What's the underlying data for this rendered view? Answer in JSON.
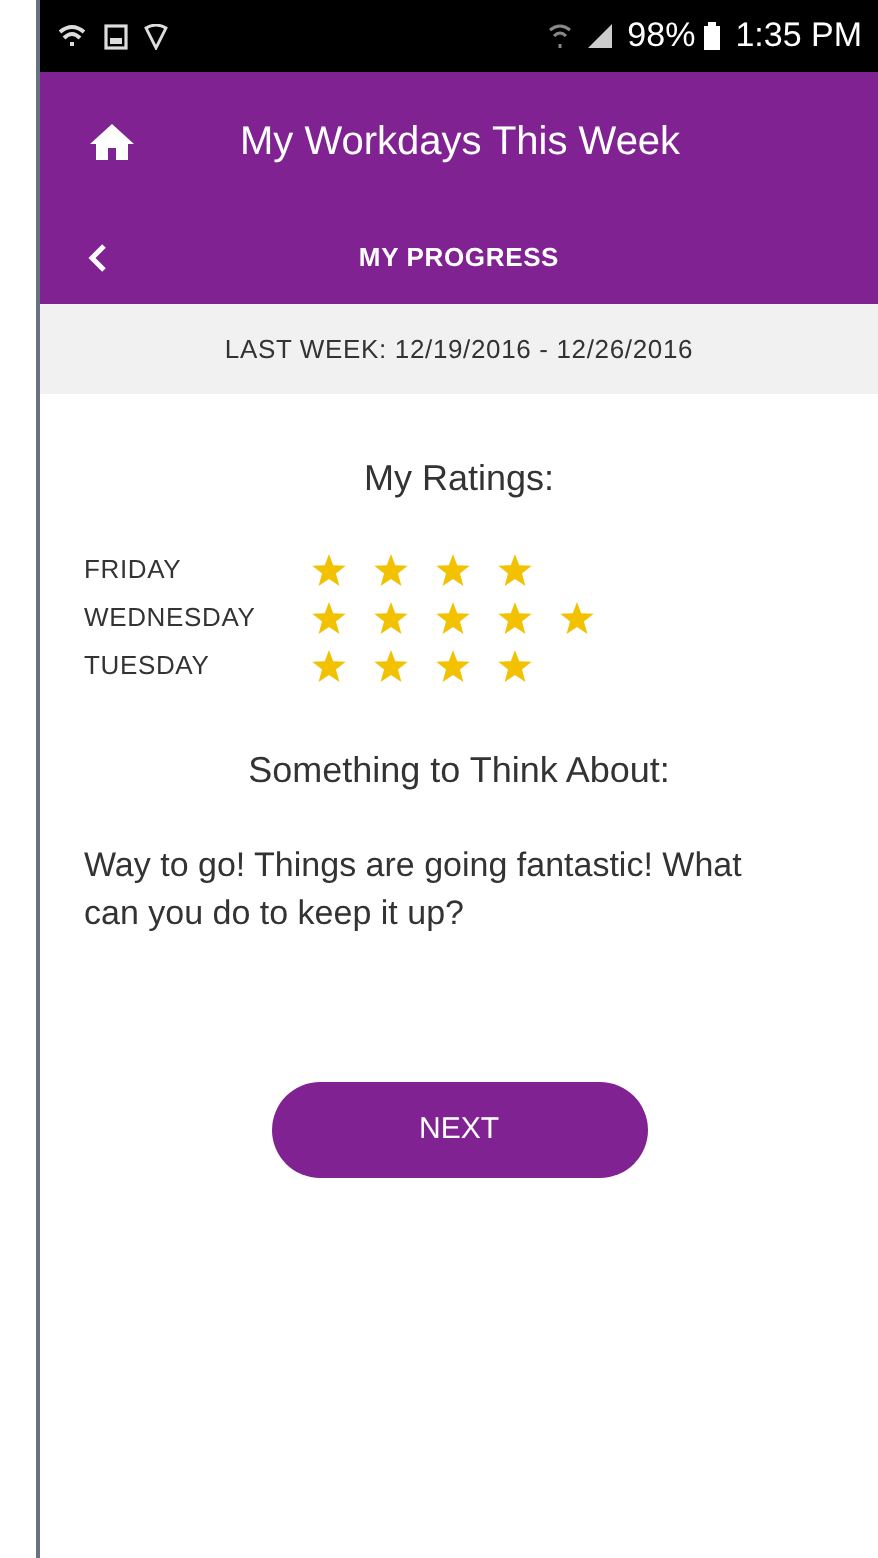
{
  "status_bar": {
    "battery": "98%",
    "time": "1:35 PM"
  },
  "header": {
    "title": "My Workdays This Week",
    "subtitle": "MY PROGRESS"
  },
  "week_banner": "LAST WEEK: 12/19/2016 - 12/26/2016",
  "ratings": {
    "title": "My Ratings:",
    "rows": [
      {
        "day": "FRIDAY",
        "stars": 4
      },
      {
        "day": "WEDNESDAY",
        "stars": 5
      },
      {
        "day": "TUESDAY",
        "stars": 4
      }
    ]
  },
  "think": {
    "title": "Something to Think About:",
    "text": "Way to go! Things are going fantastic! What can you do to keep it up?"
  },
  "next_button": "NEXT"
}
